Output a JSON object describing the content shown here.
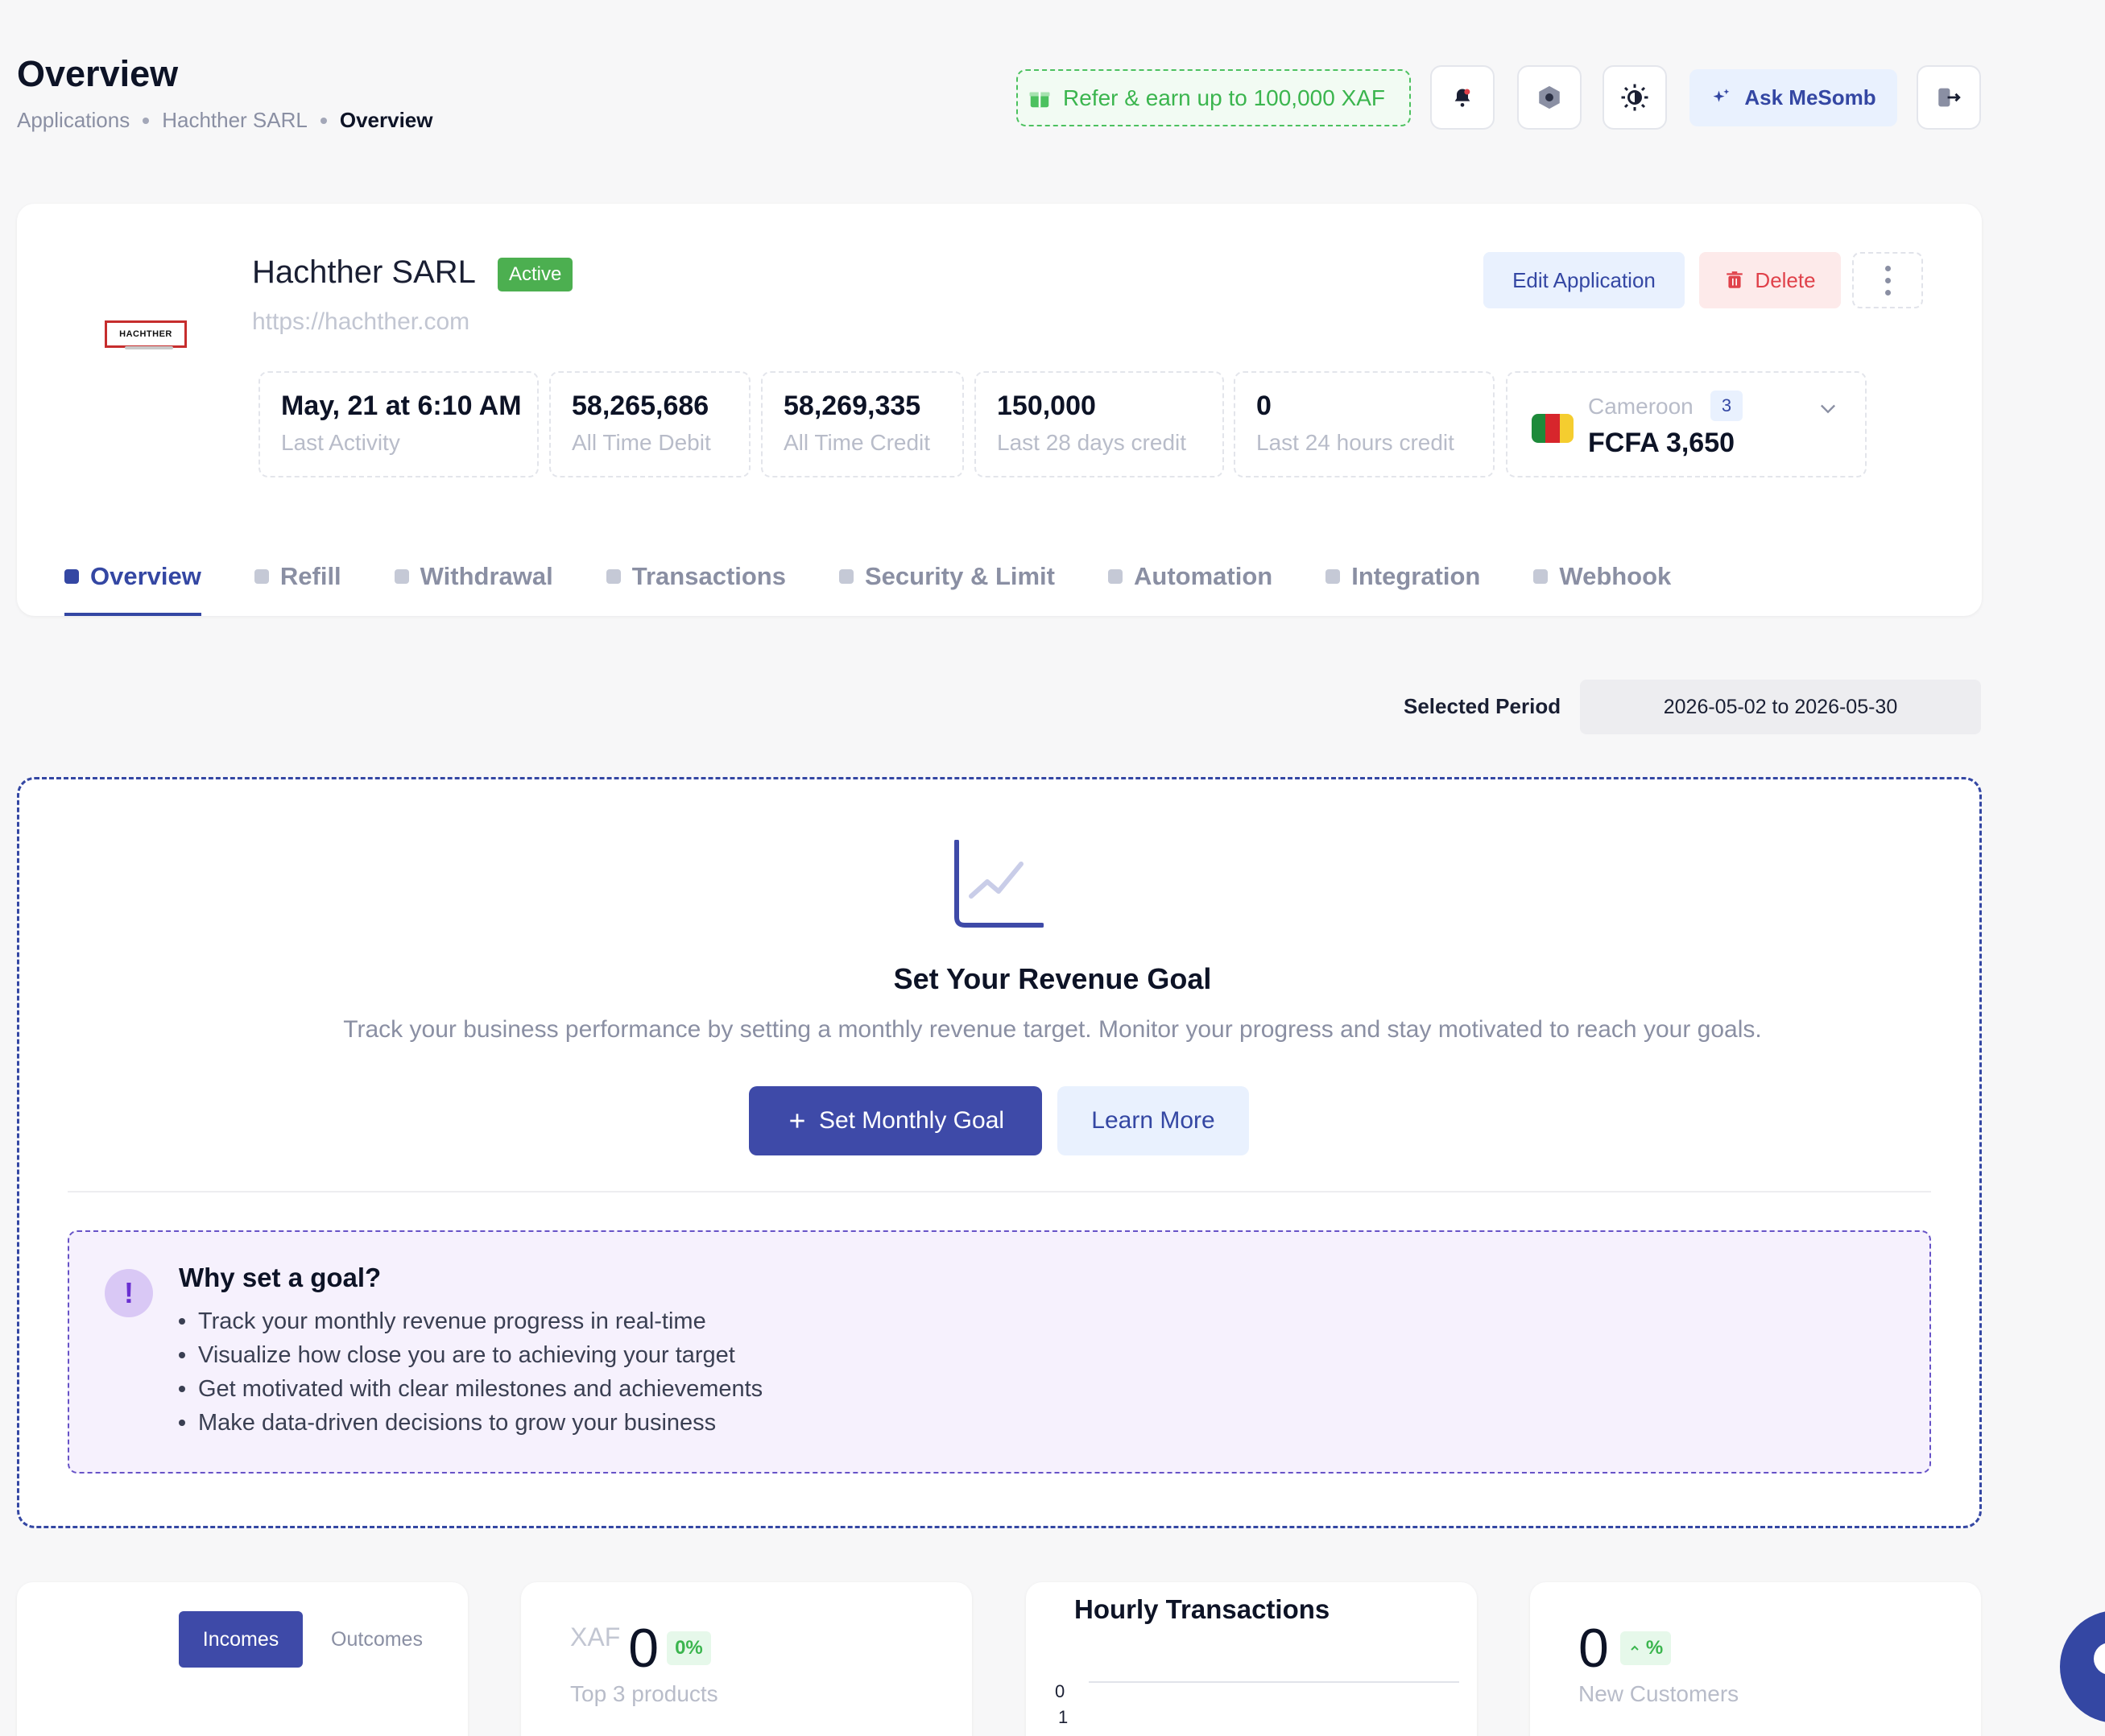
{
  "header": {
    "title": "Overview",
    "breadcrumb": [
      "Applications",
      "Hachther SARL",
      "Overview"
    ],
    "refer_label": "Refer & earn up to 100,000 XAF",
    "ask_label": "Ask MeSomb"
  },
  "app": {
    "name": "Hachther SARL",
    "status": "Active",
    "url": "https://hachther.com",
    "logo_text": "HACHTHER",
    "edit_label": "Edit Application",
    "delete_label": "Delete",
    "stats": [
      {
        "value": "May, 21 at 6:10 AM",
        "label": "Last Activity"
      },
      {
        "value": "58,265,686",
        "label": "All Time Debit"
      },
      {
        "value": "58,269,335",
        "label": "All Time Credit"
      },
      {
        "value": "150,000",
        "label": "Last 28 days credit"
      },
      {
        "value": "0",
        "label": "Last 24 hours credit"
      }
    ],
    "currency": {
      "country": "Cameroon",
      "count": "3",
      "balance": "FCFA 3,650"
    }
  },
  "tabs": [
    "Overview",
    "Refill",
    "Withdrawal",
    "Transactions",
    "Security & Limit",
    "Automation",
    "Integration",
    "Webhook"
  ],
  "period": {
    "label": "Selected Period",
    "value": "2026-05-02 to 2026-05-30"
  },
  "goal": {
    "title": "Set Your Revenue Goal",
    "description": "Track your business performance by setting a monthly revenue target. Monitor your progress and stay motivated to reach your goals.",
    "primary_label": "Set Monthly Goal",
    "secondary_label": "Learn More",
    "why_title": "Why set a goal?",
    "why_items": [
      "Track your monthly revenue progress in real-time",
      "Visualize how close you are to achieving your target",
      "Get motivated with clear milestones and achievements",
      "Make data-driven decisions to grow your business"
    ]
  },
  "cards": {
    "incomes_label": "Incomes",
    "outcomes_label": "Outcomes",
    "products": {
      "currency": "XAF",
      "value": "0",
      "pct": "0%",
      "label": "Top 3 products"
    },
    "hourly": {
      "title": "Hourly Transactions",
      "ticks": [
        "0",
        "1"
      ]
    },
    "customers": {
      "value": "0",
      "pct": "%",
      "label": "New Customers"
    }
  },
  "colors": {
    "primary": "#3E4AA8",
    "success": "#4CAF50",
    "danger": "#E0414A",
    "refer": "#3BB54E"
  }
}
